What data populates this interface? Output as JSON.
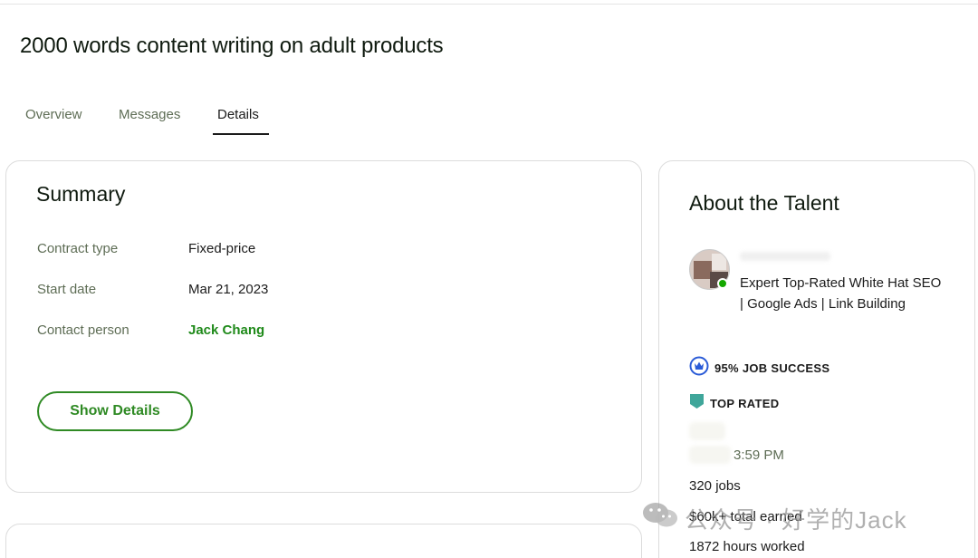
{
  "job": {
    "title": "2000 words content writing on adult products"
  },
  "tabs": [
    {
      "label": "Overview",
      "active": false
    },
    {
      "label": "Messages",
      "active": false
    },
    {
      "label": "Details",
      "active": true
    }
  ],
  "summary": {
    "heading": "Summary",
    "rows": [
      {
        "label": "Contract type",
        "value": "Fixed-price"
      },
      {
        "label": "Start date",
        "value": "Mar 21, 2023"
      },
      {
        "label": "Contact person",
        "value": "Jack Chang"
      }
    ],
    "show_details_label": "Show Details"
  },
  "talent": {
    "heading": "About the Talent",
    "headline": "Expert Top-Rated White Hat SEO | Google Ads | Link Building",
    "online": true,
    "job_success": "95% JOB SUCCESS",
    "top_rated": "TOP RATED",
    "local_time": "3:59 PM",
    "jobs": "320 jobs",
    "total_earned": "$60k+ total earned",
    "hours_worked": "1872 hours worked"
  },
  "watermark": {
    "text": "公众号 · 好学的Jack"
  },
  "colors": {
    "accent_green": "#14a800",
    "button_green": "#2f8a24",
    "muted_text": "#5e6d55",
    "job_success_blue": "#2a5bd7",
    "top_rated_teal": "#3fa69a"
  }
}
